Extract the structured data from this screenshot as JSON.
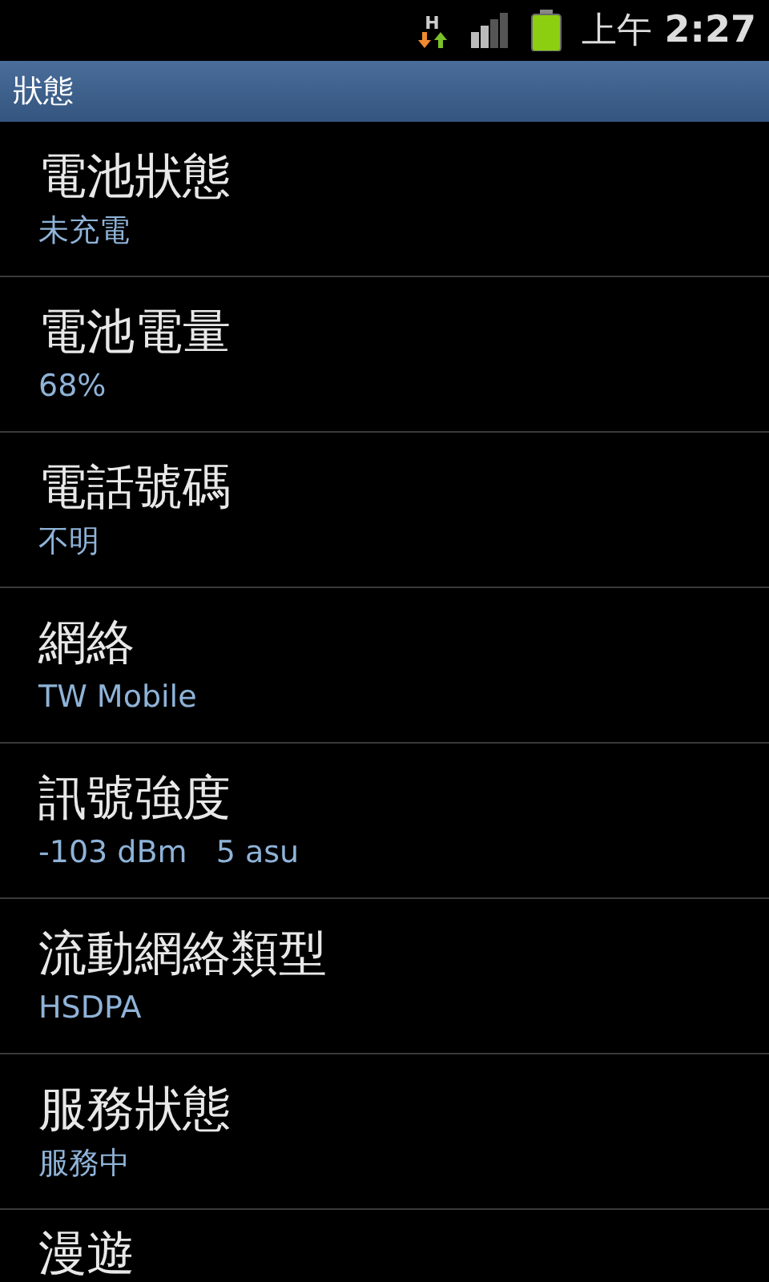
{
  "status_bar": {
    "network_type": "H",
    "time_period": "上午",
    "time": "2:27"
  },
  "header": {
    "title": "狀態"
  },
  "items": [
    {
      "title": "電池狀態",
      "summary": "未充電"
    },
    {
      "title": "電池電量",
      "summary": "68%"
    },
    {
      "title": "電話號碼",
      "summary": "不明"
    },
    {
      "title": "網絡",
      "summary": "TW Mobile"
    },
    {
      "title": "訊號強度",
      "summary": "-103 dBm   5 asu"
    },
    {
      "title": "流動網絡類型",
      "summary": "HSDPA"
    },
    {
      "title": "服務狀態",
      "summary": "服務中"
    },
    {
      "title": "漫遊"
    }
  ]
}
